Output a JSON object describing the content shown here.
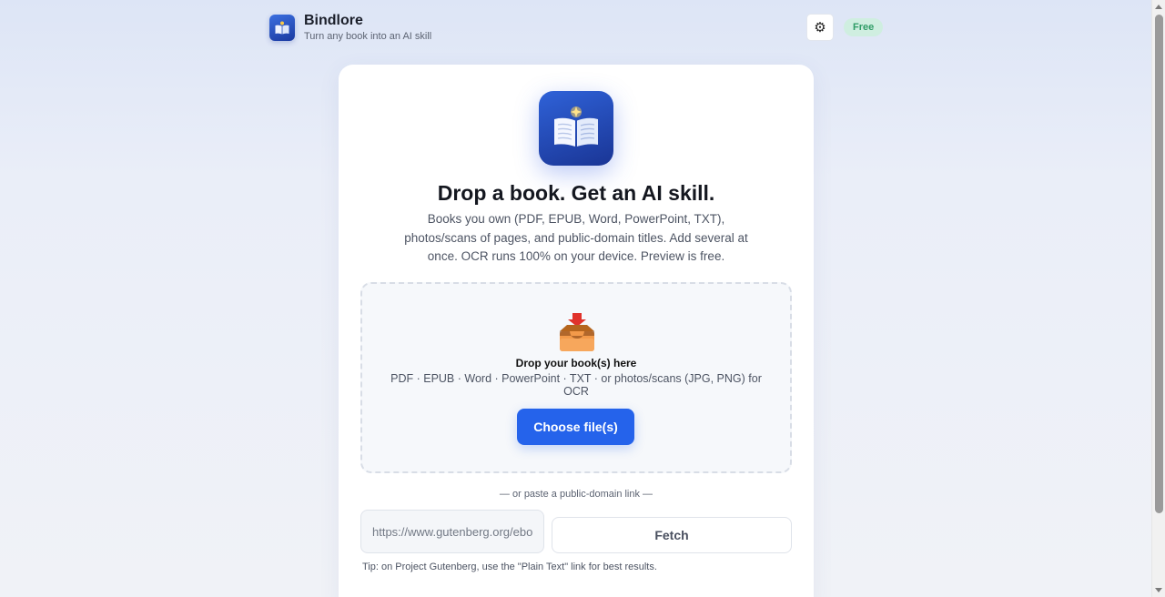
{
  "header": {
    "app_name": "Bindlore",
    "tagline": "Turn any book into an AI skill",
    "settings_icon": "gear-icon",
    "settings_glyph": "⚙",
    "plan_badge": "Free"
  },
  "hero": {
    "icon": "open-book-icon",
    "headline": "Drop a book. Get an AI skill.",
    "description": "Books you own (PDF, EPUB, Word, PowerPoint, TXT), photos/scans of pages, and public-domain titles. Add several at once. OCR runs 100% on your device. Preview is free."
  },
  "dropzone": {
    "icon": "inbox-tray-icon",
    "title": "Drop your book(s) here",
    "formats": "PDF · EPUB · Word · PowerPoint · TXT · or photos/scans (JPG, PNG) for OCR",
    "button_label": "Choose file(s)"
  },
  "link_import": {
    "divider_text": "— or paste a public-domain link —",
    "placeholder": "https://www.gutenberg.org/ebooks/...",
    "fetch_label": "Fetch",
    "tip": "Tip: on Project Gutenberg, use the \"Plain Text\" link for best results."
  },
  "colors": {
    "primary": "#2563eb",
    "badge_bg": "#cfeee0",
    "badge_text": "#2f9c66"
  }
}
